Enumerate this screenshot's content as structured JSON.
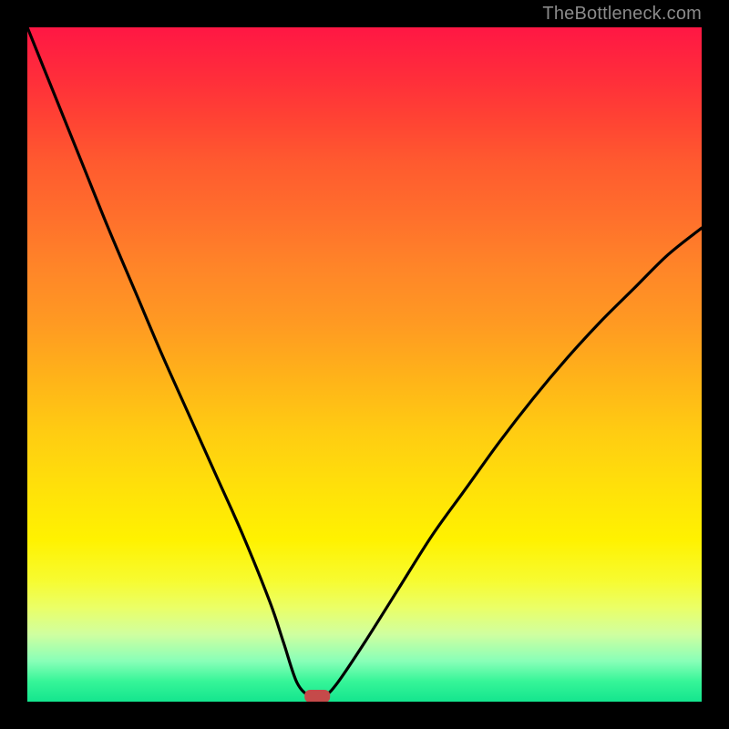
{
  "watermark": "TheBottleneck.com",
  "colors": {
    "frame": "#000000",
    "gradient_top": "#ff1744",
    "gradient_bottom": "#14e58e",
    "curve": "#000000",
    "marker": "#c54a4a",
    "watermark": "#8a8a8a"
  },
  "chart_data": {
    "type": "line",
    "title": "",
    "xlabel": "",
    "ylabel": "",
    "xlim": [
      0,
      100
    ],
    "ylim": [
      0,
      100
    ],
    "notes": "V-shaped bottleneck curve over a vertical rainbow gradient. Y=0 (green) is optimal; higher Y (red) is worse. Flat bottom segment near the minimum with a small rounded marker.",
    "series": [
      {
        "name": "bottleneck-curve",
        "x": [
          0,
          4,
          8,
          12,
          16,
          20,
          24,
          28,
          32,
          36,
          38,
          40,
          42,
          44,
          46,
          50,
          55,
          60,
          65,
          70,
          75,
          80,
          85,
          90,
          95,
          100
        ],
        "values": [
          100,
          90,
          80,
          70,
          60.5,
          51,
          42,
          33,
          24,
          14,
          8,
          2,
          0,
          0,
          2,
          8,
          16,
          24,
          31,
          38,
          44.5,
          50.5,
          56,
          61,
          66,
          70
        ]
      }
    ],
    "marker": {
      "x": 43,
      "y": 0
    },
    "flat_bottom": {
      "x_start": 42,
      "x_end": 44,
      "y": 0
    }
  }
}
